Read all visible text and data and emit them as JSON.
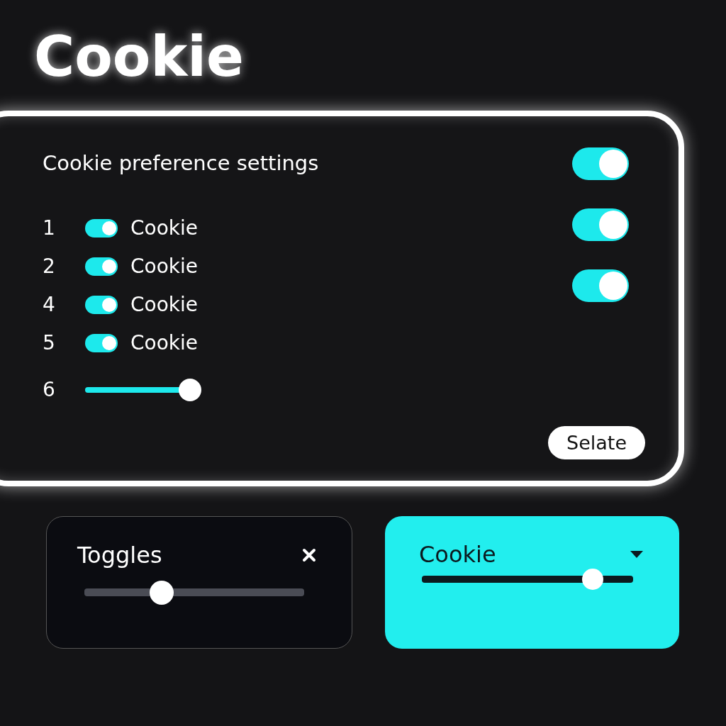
{
  "title": "Cookie",
  "panel": {
    "heading": "Cookie preference settings",
    "side_toggles": [
      {
        "on": true
      },
      {
        "on": true
      },
      {
        "on": true
      }
    ],
    "items": [
      {
        "kind": "toggle",
        "number": "1",
        "label": "Cookie",
        "on": true
      },
      {
        "kind": "toggle",
        "number": "2",
        "label": "Cookie",
        "on": true
      },
      {
        "kind": "toggle",
        "number": "4",
        "label": "Cookie",
        "on": true
      },
      {
        "kind": "toggle",
        "number": "5",
        "label": "Cookie",
        "on": true
      },
      {
        "kind": "slider",
        "number": "6",
        "level": 1.0
      }
    ],
    "button": "Selate"
  },
  "cards": [
    {
      "kind": "close",
      "title": "Toggles",
      "level": 0.35
    },
    {
      "kind": "dropdown",
      "title": "Cookie",
      "level": 0.81
    }
  ]
}
